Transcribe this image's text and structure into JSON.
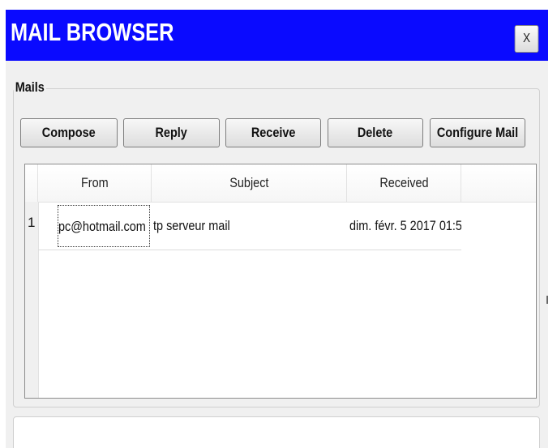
{
  "window": {
    "title": "MAIL BROWSER",
    "close_label": "X",
    "title_bar_color": "#0a0aff"
  },
  "mails_group": {
    "label": "Mails"
  },
  "toolbar": {
    "compose_label": "Compose",
    "reply_label": "Reply",
    "receive_label": "Receive",
    "delete_label": "Delete",
    "configure_label": "Configure Mail"
  },
  "table": {
    "columns": [
      "From",
      "Subject",
      "Received"
    ],
    "rows": [
      {
        "index": "1",
        "from": "pc@hotmail.com",
        "subject": "tp serveur mail",
        "received": "dim. févr. 5 2017 01:5..."
      }
    ]
  }
}
